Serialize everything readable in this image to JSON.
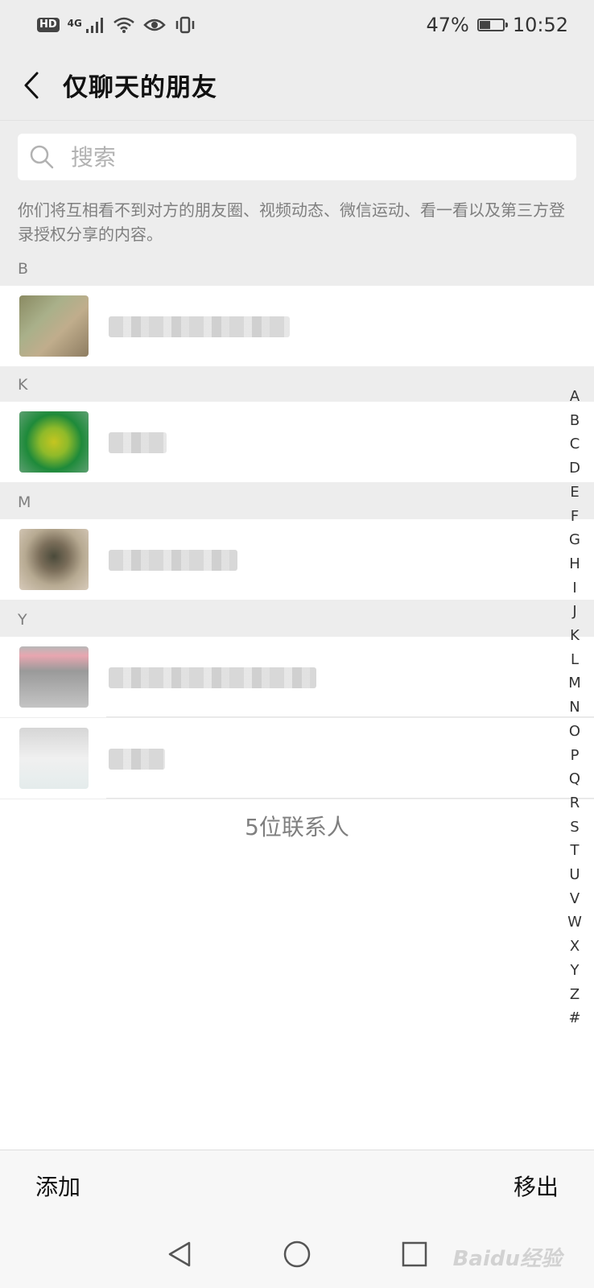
{
  "status_bar": {
    "hd_badge": "HD",
    "network": "4G",
    "battery_percent": "47%",
    "battery_level": 0.47,
    "time": "10:52"
  },
  "header": {
    "title": "仅聊天的朋友",
    "back_icon": "chevron-left-icon"
  },
  "search": {
    "placeholder": "搜索",
    "value": "",
    "icon": "search-icon"
  },
  "notice": "你们将互相看不到对方的朋友圈、视频动态、微信运动、看一看以及第三方登录授权分享的内容。",
  "sections": [
    {
      "letter": "B"
    },
    {
      "letter": "K"
    },
    {
      "letter": "M"
    },
    {
      "letter": "Y"
    }
  ],
  "contact_count": "5位联系人",
  "index_letters": [
    "A",
    "B",
    "C",
    "D",
    "E",
    "F",
    "G",
    "H",
    "I",
    "J",
    "K",
    "L",
    "M",
    "N",
    "O",
    "P",
    "Q",
    "R",
    "S",
    "T",
    "U",
    "V",
    "W",
    "X",
    "Y",
    "Z",
    "#"
  ],
  "actions": {
    "add_label": "添加",
    "remove_label": "移出"
  },
  "nav": {
    "back_icon": "triangle-back-icon",
    "home_icon": "circle-home-icon",
    "recents_icon": "square-recents-icon"
  },
  "watermark": "Baidu经验",
  "colors": {
    "background": "#ededed",
    "secondary_text": "#7f7f7f"
  }
}
